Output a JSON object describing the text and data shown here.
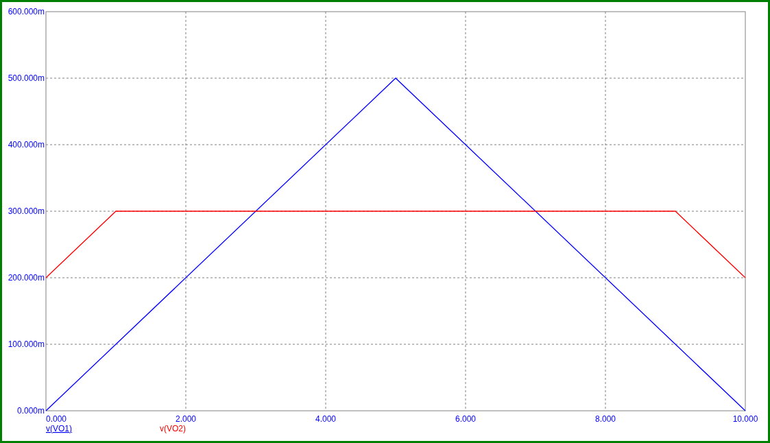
{
  "chart_data": {
    "type": "line",
    "grid": true,
    "x": [
      0,
      1,
      5,
      9,
      10
    ],
    "xlim": [
      0,
      10
    ],
    "ylim": [
      0,
      600
    ],
    "xticks": [
      {
        "value": 0,
        "label": "0.000"
      },
      {
        "value": 2,
        "label": "2.000"
      },
      {
        "value": 4,
        "label": "4.000"
      },
      {
        "value": 6,
        "label": "6.000"
      },
      {
        "value": 8,
        "label": "8.000"
      },
      {
        "value": 10,
        "label": "10.000"
      }
    ],
    "yticks": [
      {
        "value": 0,
        "label": "0.000m"
      },
      {
        "value": 100,
        "label": "100.000m"
      },
      {
        "value": 200,
        "label": "200.000m"
      },
      {
        "value": 300,
        "label": "300.000m"
      },
      {
        "value": 400,
        "label": "400.000m"
      },
      {
        "value": 500,
        "label": "500.000m"
      },
      {
        "value": 600,
        "label": "600.000m"
      }
    ],
    "series": [
      {
        "name": "v(VO1)",
        "color": "#0000ff",
        "values": [
          0,
          100,
          500,
          100,
          0
        ]
      },
      {
        "name": "v(VO2)",
        "color": "#ff0000",
        "values": [
          200,
          300,
          300,
          300,
          200
        ]
      }
    ]
  },
  "legend": [
    {
      "selected": true
    },
    {
      "selected": false
    }
  ]
}
